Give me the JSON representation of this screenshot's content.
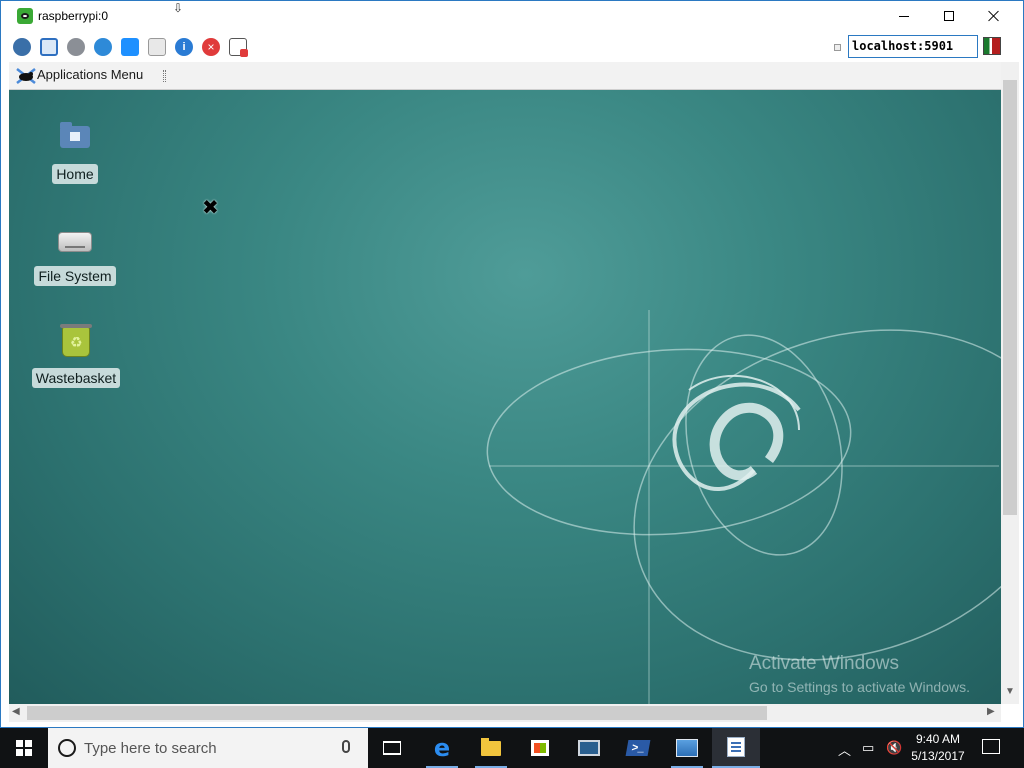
{
  "window": {
    "title": "raspberrypi:0",
    "host": "localhost:5901"
  },
  "remote_panel": {
    "apps_menu_label": "Applications Menu"
  },
  "desktop_icons": [
    {
      "label": "Home",
      "icon": "home-folder-icon"
    },
    {
      "label": "File System",
      "icon": "drive-icon"
    },
    {
      "label": "Wastebasket",
      "icon": "trash-icon"
    }
  ],
  "watermark": {
    "title": "Activate Windows",
    "subtitle": "Go to Settings to activate Windows."
  },
  "taskbar": {
    "search_placeholder": "Type here to search",
    "time": "9:40 AM",
    "date": "5/13/2017"
  },
  "colors": {
    "desktop_teal": "#3a8783",
    "taskbar": "#101214",
    "window_border": "#2b79c2"
  }
}
